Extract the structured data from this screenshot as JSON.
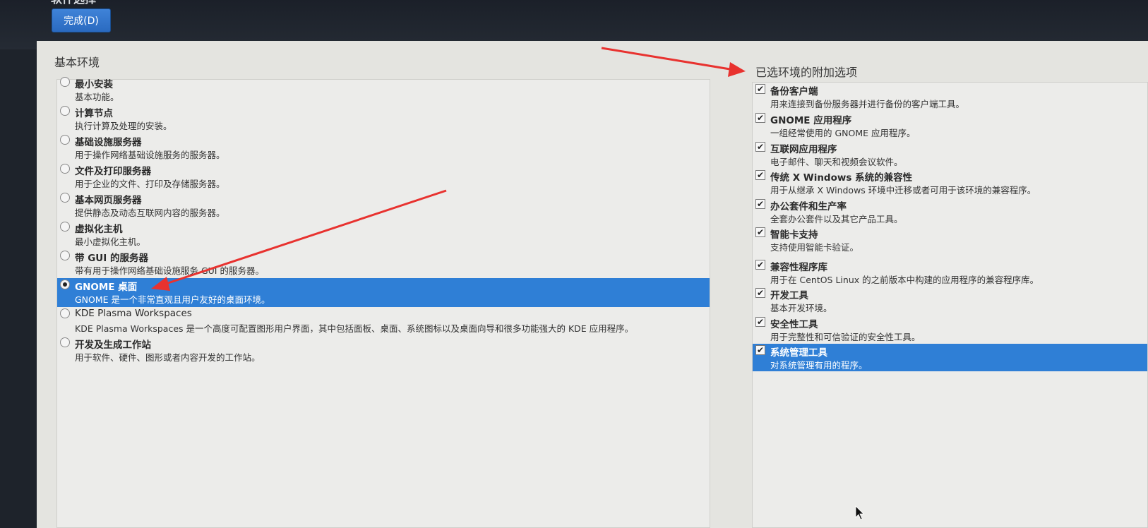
{
  "header": {
    "title": "软件选择",
    "done_label": "完成(D)"
  },
  "base_env": {
    "title": "基本环境",
    "items": [
      {
        "label": "最小安装",
        "desc": "基本功能。"
      },
      {
        "label": "计算节点",
        "desc": "执行计算及处理的安装。"
      },
      {
        "label": "基础设施服务器",
        "desc": "用于操作网络基础设施服务的服务器。"
      },
      {
        "label": "文件及打印服务器",
        "desc": "用于企业的文件、打印及存储服务器。"
      },
      {
        "label": "基本网页服务器",
        "desc": "提供静态及动态互联网内容的服务器。"
      },
      {
        "label": "虚拟化主机",
        "desc": "最小虚拟化主机。"
      },
      {
        "label": "带 GUI 的服务器",
        "desc": "带有用于操作网络基础设施服务 GUI 的服务器。"
      },
      {
        "label": "GNOME 桌面",
        "desc": "GNOME 是一个非常直观且用户友好的桌面环境。",
        "selected": true
      },
      {
        "label": "KDE Plasma Workspaces",
        "desc": "KDE Plasma Workspaces 是一个高度可配置图形用户界面，其中包括面板、桌面、系统图标以及桌面向导和很多功能强大的 KDE 应用程序。"
      },
      {
        "label": "开发及生成工作站",
        "desc": "用于软件、硬件、图形或者内容开发的工作站。"
      }
    ]
  },
  "addons": {
    "title": "已选环境的附加选项",
    "items": [
      {
        "label": "备份客户端",
        "desc": "用来连接到备份服务器并进行备份的客户端工具。",
        "checked": true
      },
      {
        "label": "GNOME 应用程序",
        "desc": "一组经常使用的 GNOME 应用程序。",
        "checked": true
      },
      {
        "label": "互联网应用程序",
        "desc": "电子邮件、聊天和视频会议软件。",
        "checked": true
      },
      {
        "label": "传统 X Windows 系统的兼容性",
        "desc": "用于从继承 X Windows 环境中迁移或者可用于该环境的兼容程序。",
        "checked": true
      },
      {
        "label": "办公套件和生产率",
        "desc": "全套办公套件以及其它产品工具。",
        "checked": true
      },
      {
        "label": "智能卡支持",
        "desc": "支持使用智能卡验证。",
        "checked": true
      },
      {
        "label": "兼容性程序库",
        "desc": "用于在 CentOS Linux 的之前版本中构建的应用程序的兼容程序库。",
        "checked": true
      },
      {
        "label": "开发工具",
        "desc": "基本开发环境。",
        "checked": true
      },
      {
        "label": "安全性工具",
        "desc": "用于完整性和可信验证的安全性工具。",
        "checked": true
      },
      {
        "label": "系统管理工具",
        "desc": "对系统管理有用的程序。",
        "checked": true,
        "selected": true
      }
    ]
  },
  "check_glyph": "✔",
  "colors": {
    "selection": "#2f7fd6",
    "annotation_arrow": "#e8322f"
  }
}
